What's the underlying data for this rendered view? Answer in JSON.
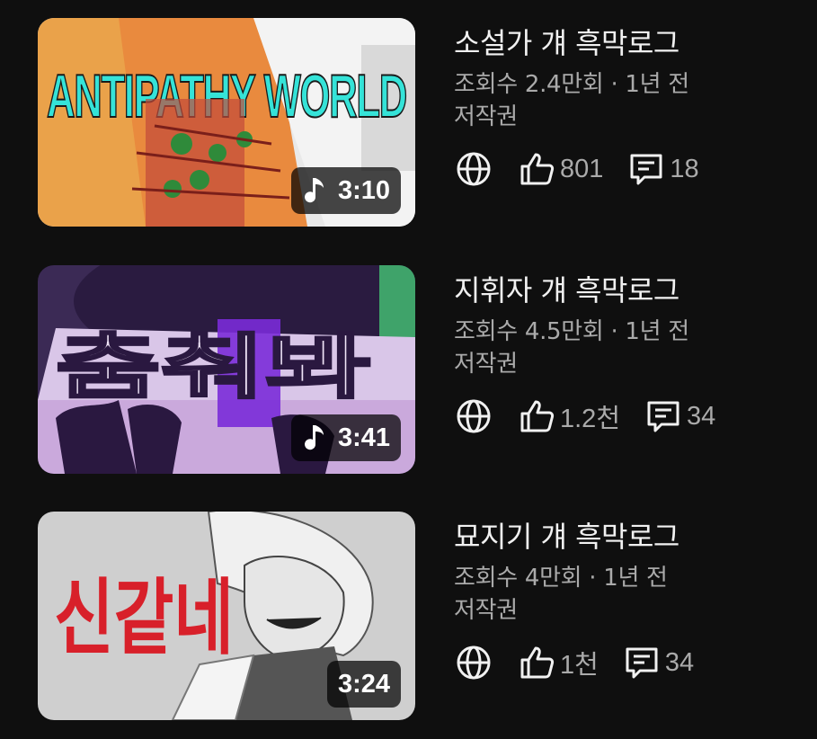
{
  "videos": [
    {
      "title": "소설가 걔 흑막로그",
      "views_age": "조회수 2.4만회 · 1년 전",
      "license": "저작권",
      "likes": "801",
      "comments": "18",
      "duration": "3:10",
      "has_music_icon": true,
      "thumb_text": "ANTIPATHY WORLD"
    },
    {
      "title": "지휘자 걔 흑막로그",
      "views_age": "조회수 4.5만회 · 1년 전",
      "license": "저작권",
      "likes": "1.2천",
      "comments": "34",
      "duration": "3:41",
      "has_music_icon": true,
      "thumb_text": "춤춰봐"
    },
    {
      "title": "묘지기 걔 흑막로그",
      "views_age": "조회수 4만회 · 1년 전",
      "license": "저작권",
      "likes": "1천",
      "comments": "34",
      "duration": "3:24",
      "has_music_icon": false,
      "thumb_text": "신같네"
    }
  ]
}
